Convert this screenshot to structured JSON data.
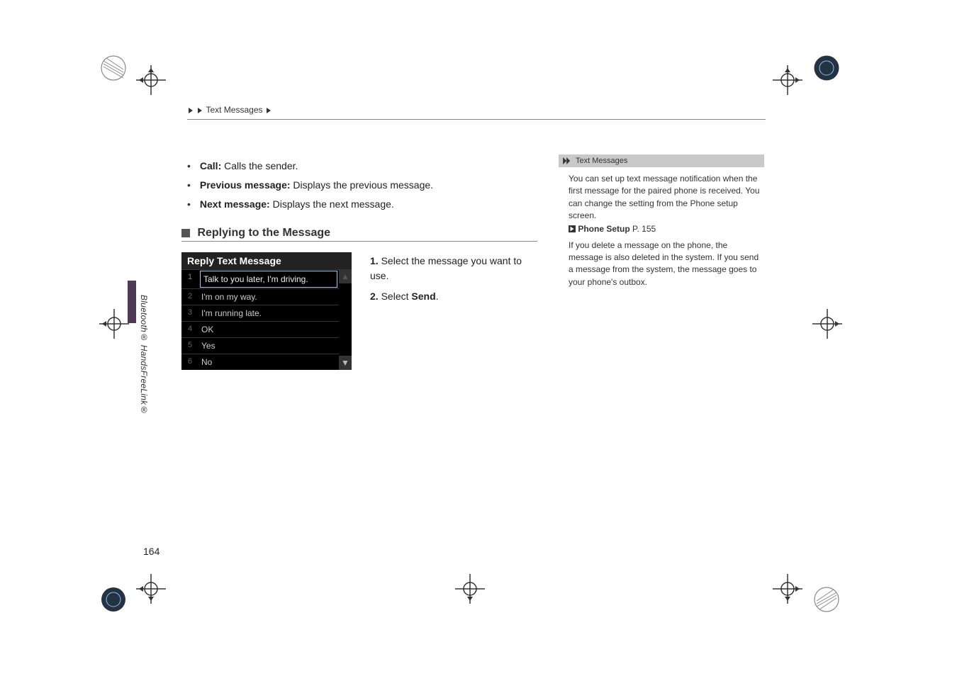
{
  "breadcrumb": {
    "items": [
      "",
      "Text Messages",
      ""
    ]
  },
  "bullets": [
    {
      "strong": "Call:",
      "text": " Calls the sender."
    },
    {
      "strong": "Previous message:",
      "text": " Displays the previous message."
    },
    {
      "strong": "Next message:",
      "text": " Displays the next message."
    }
  ],
  "section": {
    "label": "Replying to the Message"
  },
  "screenshot": {
    "title": "Reply Text Message",
    "items": [
      {
        "n": "1",
        "t": "Talk to you later, I'm driving.",
        "hi": true
      },
      {
        "n": "2",
        "t": "I'm on my way."
      },
      {
        "n": "3",
        "t": "I'm running late."
      },
      {
        "n": "4",
        "t": "OK"
      },
      {
        "n": "5",
        "t": "Yes"
      },
      {
        "n": "6",
        "t": "No"
      }
    ],
    "scroll_up": "▲",
    "scroll_down": "▼"
  },
  "steps": {
    "step1_prefix": "1. ",
    "step1_text": "Select the message you want to use.",
    "step2_prefix": "2. ",
    "step2_text_a": "Select ",
    "step2_strong": "Send",
    "step2_text_b": "."
  },
  "sidebar": {
    "title": "Text Messages",
    "para1": "You can set up text message notification when the first message for the paired phone is received. You can change the setting from the Phone setup screen.",
    "ref_label": "Phone Setup",
    "ref_page": " P. 155",
    "para2": "If you delete a message on the phone, the message is also deleted in the system. If you send a message from the system, the message goes to your phone's outbox."
  },
  "side_text": "Bluetooth® HandsFreeLink®",
  "page_number": "164"
}
